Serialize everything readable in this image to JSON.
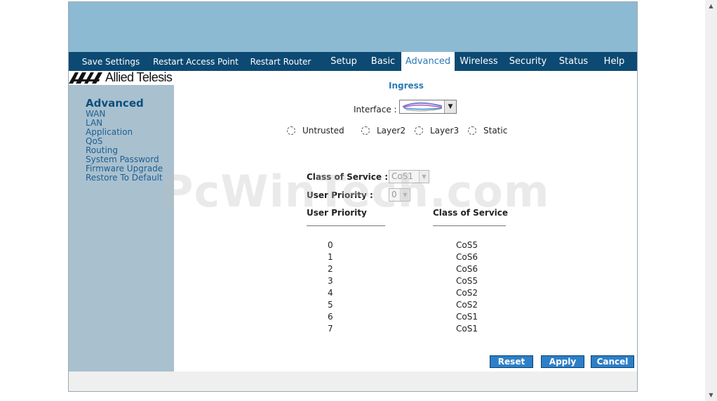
{
  "nav": {
    "save_settings": "Save Settings",
    "restart_ap": "Restart Access Point",
    "restart_router": "Restart Router",
    "setup": "Setup",
    "basic": "Basic",
    "advanced": "Advanced",
    "wireless": "Wireless",
    "security": "Security",
    "status": "Status",
    "help": "Help"
  },
  "logo": {
    "text": "Allied Telesis"
  },
  "sidebar": {
    "heading": "Advanced",
    "items": [
      {
        "label": "WAN"
      },
      {
        "label": "LAN"
      },
      {
        "label": "Application"
      },
      {
        "label": "QoS"
      },
      {
        "label": "Routing"
      },
      {
        "label": "System Password"
      },
      {
        "label": "Firmware Upgrade"
      },
      {
        "label": "Restore To Default"
      }
    ]
  },
  "main": {
    "title": "Ingress",
    "interface_label": "Interface :",
    "radios": {
      "untrusted": "Untrusted",
      "layer2": "Layer2",
      "layer3": "Layer3",
      "static": "Static"
    },
    "cos_label": "Class of Service :",
    "cos_value": "CoS1",
    "priority_label": "User Priority :",
    "priority_value": "0",
    "col_priority": "User Priority",
    "col_cos": "Class of Service",
    "rows": [
      {
        "priority": "0",
        "cos": "CoS5"
      },
      {
        "priority": "1",
        "cos": "CoS6"
      },
      {
        "priority": "2",
        "cos": "CoS6"
      },
      {
        "priority": "3",
        "cos": "CoS5"
      },
      {
        "priority": "4",
        "cos": "CoS2"
      },
      {
        "priority": "5",
        "cos": "CoS2"
      },
      {
        "priority": "6",
        "cos": "CoS1"
      },
      {
        "priority": "7",
        "cos": "CoS1"
      }
    ],
    "buttons": {
      "reset": "Reset",
      "apply": "Apply",
      "cancel": "Cancel"
    }
  },
  "watermark": "PcWinTech.com",
  "colors": {
    "nav_bg": "#0c4a73",
    "banner": "#8cbad2",
    "sidebar_bg": "#a9c0cf",
    "button": "#2d7fc8"
  }
}
